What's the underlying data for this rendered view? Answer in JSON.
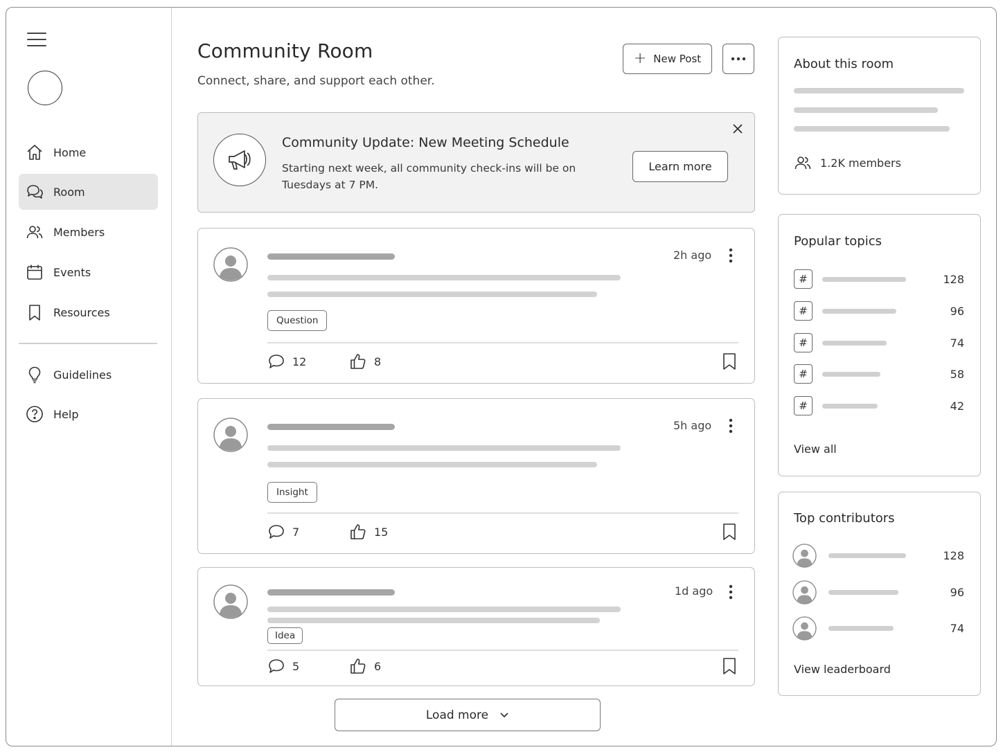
{
  "sidebar": {
    "items": [
      {
        "label": "Home",
        "icon": "home-icon"
      },
      {
        "label": "Room",
        "icon": "chat-bubbles-icon",
        "active": true
      },
      {
        "label": "Members",
        "icon": "users-icon"
      },
      {
        "label": "Events",
        "icon": "calendar-icon"
      },
      {
        "label": "Resources",
        "icon": "bookmark-icon"
      }
    ],
    "secondary": [
      {
        "label": "Guidelines",
        "icon": "lightbulb-icon"
      },
      {
        "label": "Help",
        "icon": "help-circle-icon"
      }
    ]
  },
  "header": {
    "title": "Community Room",
    "subtitle": "Connect, share, and support each other.",
    "new_post_label": "New Post"
  },
  "announcement": {
    "title": "Community Update: New Meeting Schedule",
    "body": "Starting next week, all community check-ins will be on Tuesdays at 7 PM.",
    "button_label": "Learn more"
  },
  "posts": [
    {
      "time": "2h ago",
      "tag": "Question",
      "comments": "12",
      "likes": "8"
    },
    {
      "time": "5h ago",
      "tag": "Insight",
      "comments": "7",
      "likes": "15"
    },
    {
      "time": "1d ago",
      "tag": "Idea",
      "comments": "5",
      "likes": "6"
    }
  ],
  "load_more_label": "Load more",
  "about": {
    "title": "About this room",
    "members": "1.2K members"
  },
  "popular_topics": {
    "title": "Popular topics",
    "hash_symbol": "#",
    "counts": [
      "128",
      "96",
      "74",
      "58",
      "42"
    ],
    "link": "View all"
  },
  "top_contributors": {
    "title": "Top contributors",
    "counts": [
      "128",
      "96",
      "74"
    ],
    "link": "View leaderboard"
  },
  "colors": {
    "border": "#bdbdbd",
    "active_nav_bg": "#e6e6e6",
    "announcement_bg": "#f2f2f2",
    "skeleton_dark": "#a6a6a6",
    "skeleton_light": "#d2d2d2"
  }
}
